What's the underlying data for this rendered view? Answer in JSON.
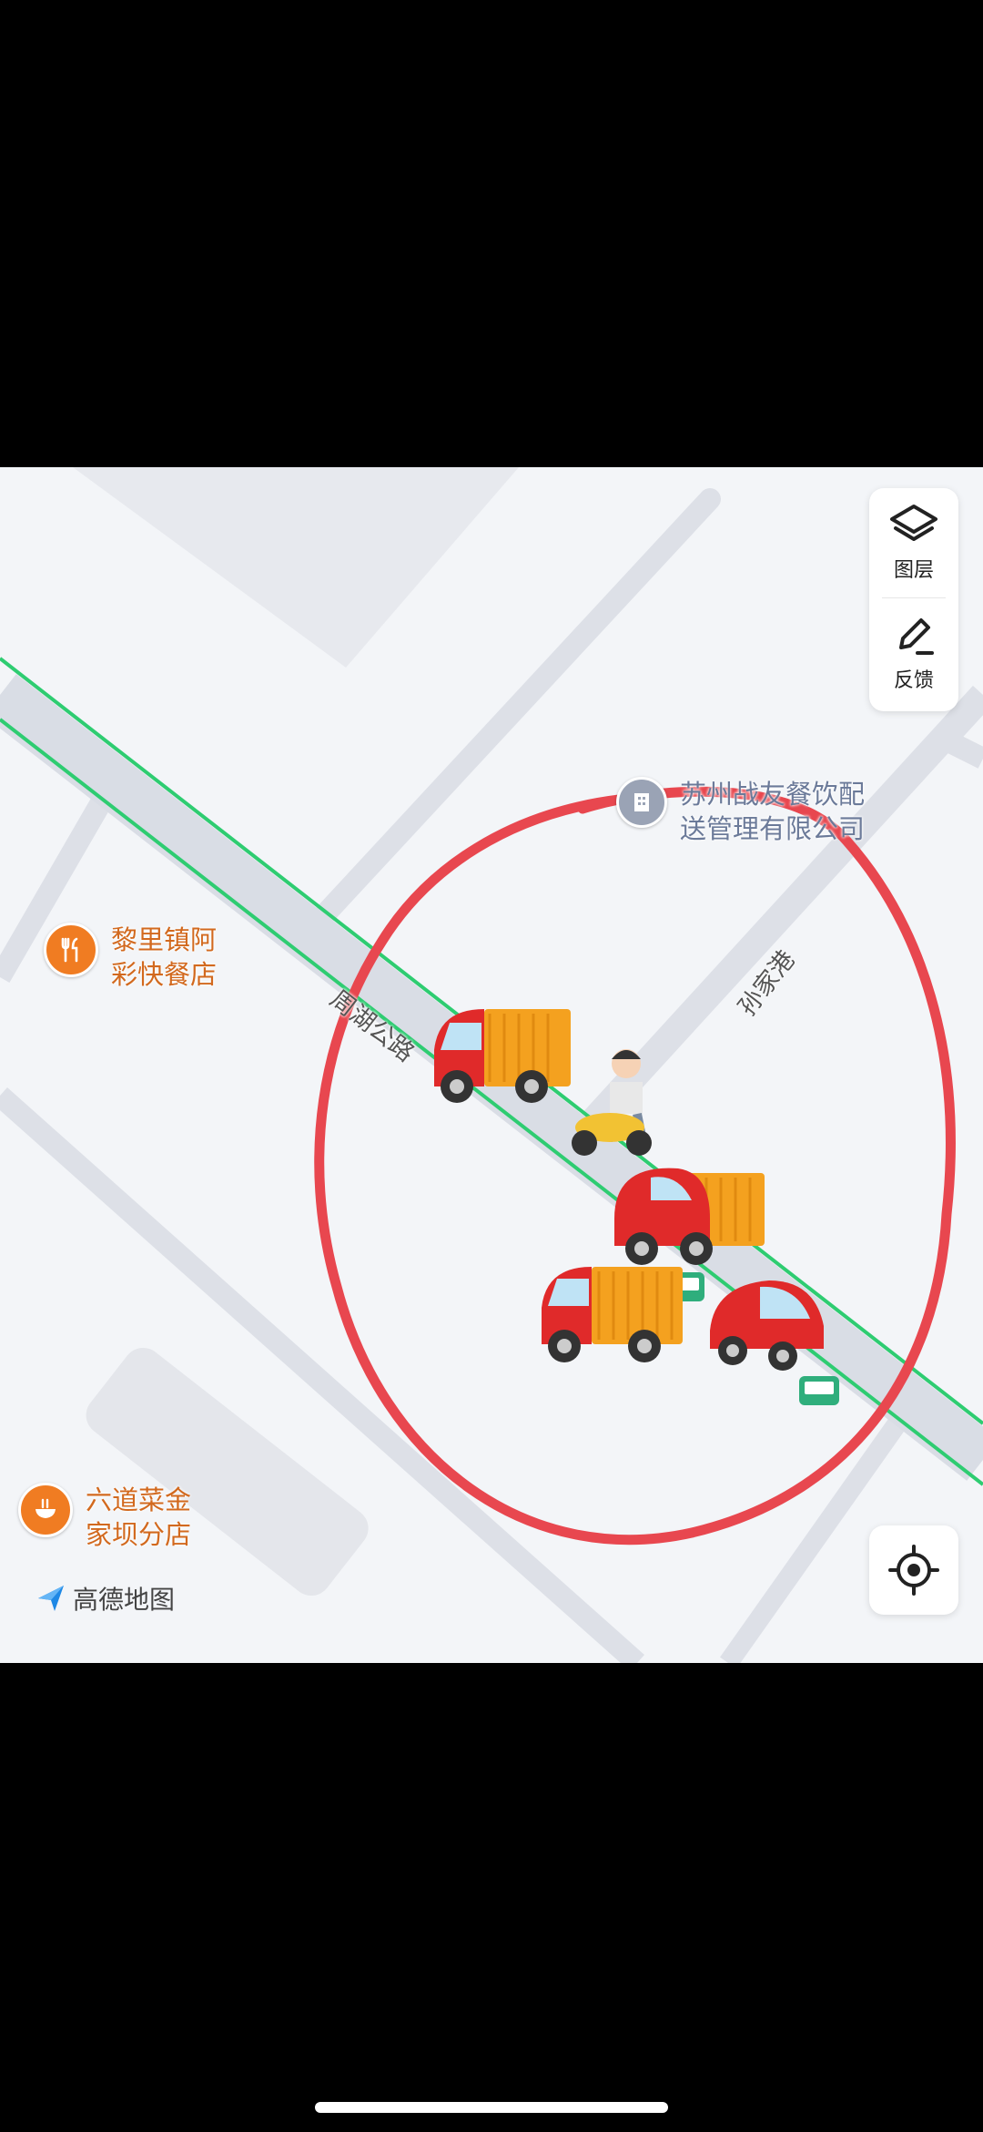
{
  "map": {
    "provider_logo": "高德地图",
    "roads": {
      "main_road": "周湖公路",
      "side_road": "孙家港"
    },
    "pois": [
      {
        "name": "黎里镇阿\n彩快餐店",
        "icon": "restaurant-icon",
        "color": "#f07c22"
      },
      {
        "name": "六道菜金\n家坝分店",
        "icon": "noodle-bowl-icon",
        "color": "#f07c22"
      },
      {
        "name": "苏州战友餐饮配\n送管理有限公司",
        "icon": "company-icon",
        "color": "#9aa3b5"
      }
    ],
    "controls": {
      "layers_label": "图层",
      "feedback_label": "反馈"
    },
    "annotation_color": "#e8474f",
    "route_color": "#2ecc71"
  }
}
